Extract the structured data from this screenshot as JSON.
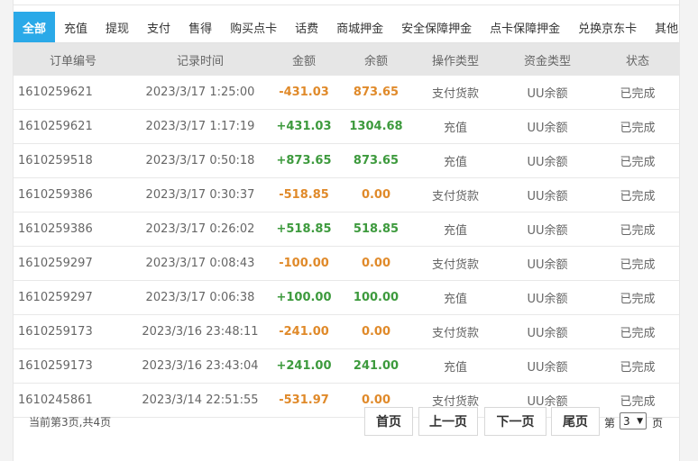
{
  "tabs": [
    "全部",
    "充值",
    "提现",
    "支付",
    "售得",
    "购买点卡",
    "话费",
    "商城押金",
    "安全保障押金",
    "点卡保障押金",
    "兑换京东卡",
    "其他"
  ],
  "table": {
    "headers": [
      "订单编号",
      "记录时间",
      "金额",
      "余额",
      "操作类型",
      "资金类型",
      "状态"
    ],
    "rows": [
      {
        "id": "1610259621",
        "time": "2023/3/17 1:25:00",
        "amount": "-431.03",
        "balance": "873.65",
        "op": "支付货款",
        "fund": "UU余额",
        "status": "已完成",
        "amount_color": "orange",
        "balance_color": "orange"
      },
      {
        "id": "1610259621",
        "time": "2023/3/17 1:17:19",
        "amount": "+431.03",
        "balance": "1304.68",
        "op": "充值",
        "fund": "UU余额",
        "status": "已完成",
        "amount_color": "green",
        "balance_color": "green"
      },
      {
        "id": "1610259518",
        "time": "2023/3/17 0:50:18",
        "amount": "+873.65",
        "balance": "873.65",
        "op": "充值",
        "fund": "UU余额",
        "status": "已完成",
        "amount_color": "green",
        "balance_color": "green"
      },
      {
        "id": "1610259386",
        "time": "2023/3/17 0:30:37",
        "amount": "-518.85",
        "balance": "0.00",
        "op": "支付货款",
        "fund": "UU余额",
        "status": "已完成",
        "amount_color": "orange",
        "balance_color": "orange"
      },
      {
        "id": "1610259386",
        "time": "2023/3/17 0:26:02",
        "amount": "+518.85",
        "balance": "518.85",
        "op": "充值",
        "fund": "UU余额",
        "status": "已完成",
        "amount_color": "green",
        "balance_color": "green"
      },
      {
        "id": "1610259297",
        "time": "2023/3/17 0:08:43",
        "amount": "-100.00",
        "balance": "0.00",
        "op": "支付货款",
        "fund": "UU余额",
        "status": "已完成",
        "amount_color": "orange",
        "balance_color": "orange"
      },
      {
        "id": "1610259297",
        "time": "2023/3/17 0:06:38",
        "amount": "+100.00",
        "balance": "100.00",
        "op": "充值",
        "fund": "UU余额",
        "status": "已完成",
        "amount_color": "green",
        "balance_color": "green"
      },
      {
        "id": "1610259173",
        "time": "2023/3/16 23:48:11",
        "amount": "-241.00",
        "balance": "0.00",
        "op": "支付货款",
        "fund": "UU余额",
        "status": "已完成",
        "amount_color": "orange",
        "balance_color": "orange"
      },
      {
        "id": "1610259173",
        "time": "2023/3/16 23:43:04",
        "amount": "+241.00",
        "balance": "241.00",
        "op": "充值",
        "fund": "UU余额",
        "status": "已完成",
        "amount_color": "green",
        "balance_color": "green"
      },
      {
        "id": "1610245861",
        "time": "2023/3/14 22:51:55",
        "amount": "-531.97",
        "balance": "0.00",
        "op": "支付货款",
        "fund": "UU余额",
        "status": "已完成",
        "amount_color": "orange",
        "balance_color": "orange"
      }
    ]
  },
  "pagination": {
    "info": "当前第3页,共4页",
    "first": "首页",
    "prev": "上一页",
    "next": "下一页",
    "last": "尾页",
    "di": "第",
    "selected": "3",
    "ye": "页"
  },
  "colors": {
    "accent": "#2aa9e8",
    "orange": "#e08a2a",
    "green": "#3d9a3d"
  }
}
